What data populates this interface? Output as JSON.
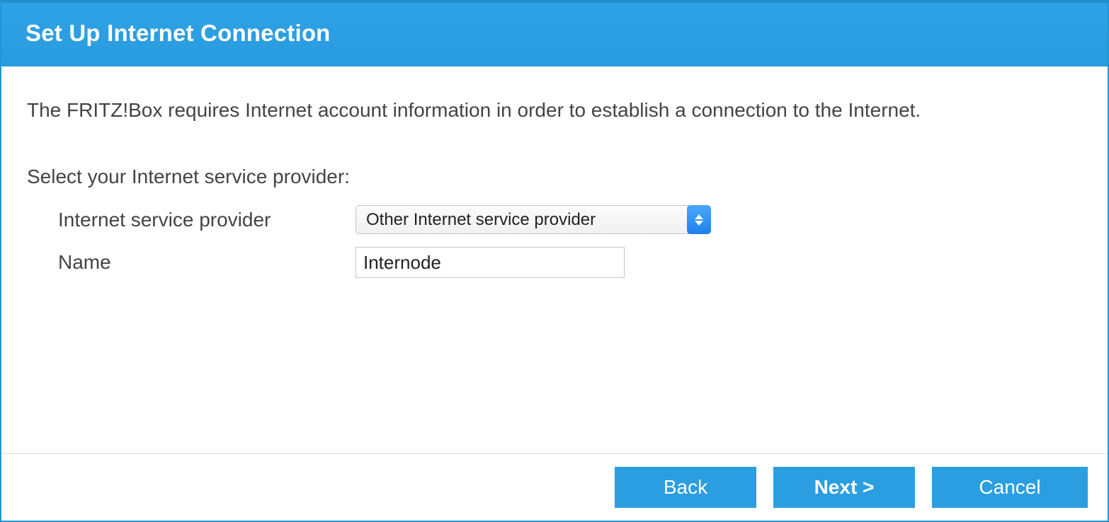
{
  "header": {
    "title": "Set Up Internet Connection"
  },
  "content": {
    "intro": "The FRITZ!Box requires Internet account information in order to establish a connection to the Internet.",
    "section_label": "Select your Internet service provider:",
    "fields": {
      "isp": {
        "label": "Internet service provider",
        "selected": "Other Internet service provider"
      },
      "name": {
        "label": "Name",
        "value": "Internode"
      }
    }
  },
  "footer": {
    "back": "Back",
    "next": "Next >",
    "cancel": "Cancel"
  }
}
